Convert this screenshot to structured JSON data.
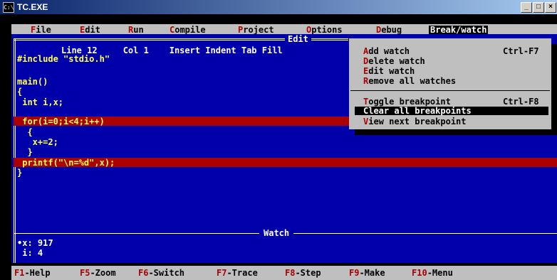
{
  "window": {
    "title": "TC.EXE",
    "icon": "C:\\",
    "minimize": "_",
    "maximize": "□",
    "close": "×"
  },
  "menubar": {
    "items": [
      {
        "hot": "F",
        "rest": "ile"
      },
      {
        "hot": "E",
        "rest": "dit"
      },
      {
        "hot": "R",
        "rest": "un"
      },
      {
        "hot": "C",
        "rest": "ompile"
      },
      {
        "hot": "P",
        "rest": "roject"
      },
      {
        "hot": "O",
        "rest": "ptions"
      },
      {
        "hot": "D",
        "rest": "ebug"
      },
      {
        "hot": "",
        "rest": "Break/watch"
      }
    ]
  },
  "editor": {
    "title": "Edit",
    "status": "Line 12     Col 1    Insert Indent Tab Fill",
    "code": [
      "#include \"stdio.h\"",
      "",
      "main()",
      "{",
      " int i,x;",
      "",
      " for(i=0;i<4;i++)",
      "  {",
      "   x+=2;",
      "  }",
      " printf(\"\\n=%d\",x);",
      "}"
    ]
  },
  "watch": {
    "title": "Watch",
    "lines": [
      "•x: 917",
      " i: 4"
    ]
  },
  "breakwatch_menu": {
    "group1": [
      {
        "hot": "A",
        "rest": "dd watch",
        "shortcut": "Ctrl-F7"
      },
      {
        "hot": "D",
        "rest": "elete watch",
        "shortcut": ""
      },
      {
        "hot": "E",
        "rest": "dit watch",
        "shortcut": ""
      },
      {
        "hot": "R",
        "rest": "emove all watches",
        "shortcut": ""
      }
    ],
    "group2": [
      {
        "hot": "T",
        "rest": "oggle breakpoint",
        "shortcut": "Ctrl-F8"
      },
      {
        "hot": "C",
        "rest": "lear all breakpoints",
        "shortcut": ""
      },
      {
        "hot": "V",
        "rest": "iew next breakpoint",
        "shortcut": ""
      }
    ]
  },
  "statusbar": {
    "keys": [
      {
        "key": "F1",
        "label": "-Help"
      },
      {
        "key": "F5",
        "label": "-Zoom"
      },
      {
        "key": "F6",
        "label": "-Switch"
      },
      {
        "key": "F7",
        "label": "-Trace"
      },
      {
        "key": "F8",
        "label": "-Step"
      },
      {
        "key": "F9",
        "label": "-Make"
      },
      {
        "key": "F10",
        "label": "-Menu"
      }
    ]
  },
  "colors": {
    "editor_bg": "#0000aa",
    "code_text": "#ffff55",
    "breakpoint_bg": "#aa0000",
    "menu_bg": "#bfbfbf",
    "hotkey": "#aa0000"
  }
}
